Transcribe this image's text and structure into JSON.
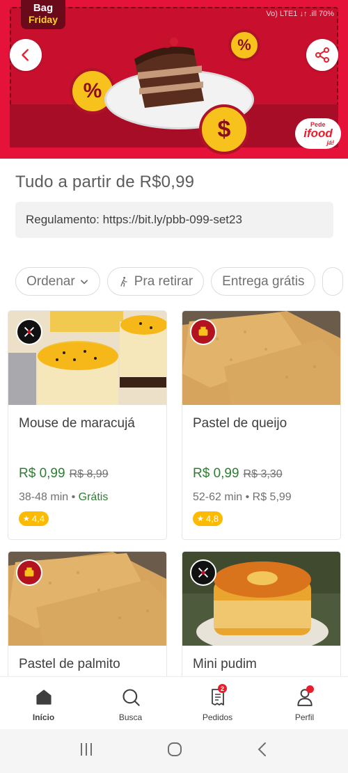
{
  "banner": {
    "logo_line1": "Bag",
    "logo_line2": "Friday",
    "status_text": "Vo) LTE1 ↓↑ .ill 70%",
    "coin_symbols": [
      "%",
      "%",
      "$"
    ],
    "partner_badge": {
      "pede": "Pede",
      "brand": "ifood",
      "ja": "já!"
    }
  },
  "title": "Tudo a partir de R$0,99",
  "rules": "Regulamento: https://bit.ly/pbb-099-set23",
  "filters": [
    {
      "label": "Ordenar",
      "icon": "chevron-down-icon"
    },
    {
      "label": "Pra retirar",
      "icon": "walking-icon"
    },
    {
      "label": "Entrega grátis"
    }
  ],
  "products": [
    {
      "name": "Mouse de maracujá",
      "price": "R$ 0,99",
      "old_price": "R$ 8,99",
      "time": "38-48 min",
      "delivery": "Grátis",
      "rating": "4,4"
    },
    {
      "name": "Pastel de queijo",
      "price": "R$ 0,99",
      "old_price": "R$ 3,30",
      "time": "52-62 min",
      "delivery": "R$ 5,99",
      "rating": "4,8"
    },
    {
      "name": "Pastel de palmito"
    },
    {
      "name": "Mini pudim"
    }
  ],
  "nav": [
    {
      "label": "Início",
      "icon": "home-icon"
    },
    {
      "label": "Busca",
      "icon": "search-icon"
    },
    {
      "label": "Pedidos",
      "icon": "orders-icon",
      "badge": "2"
    },
    {
      "label": "Perfil",
      "icon": "profile-icon"
    }
  ],
  "colors": {
    "brand": "#ea1d2c",
    "banner": "#e5133a",
    "price_green": "#2e7d32",
    "rating": "#fcbb00"
  }
}
